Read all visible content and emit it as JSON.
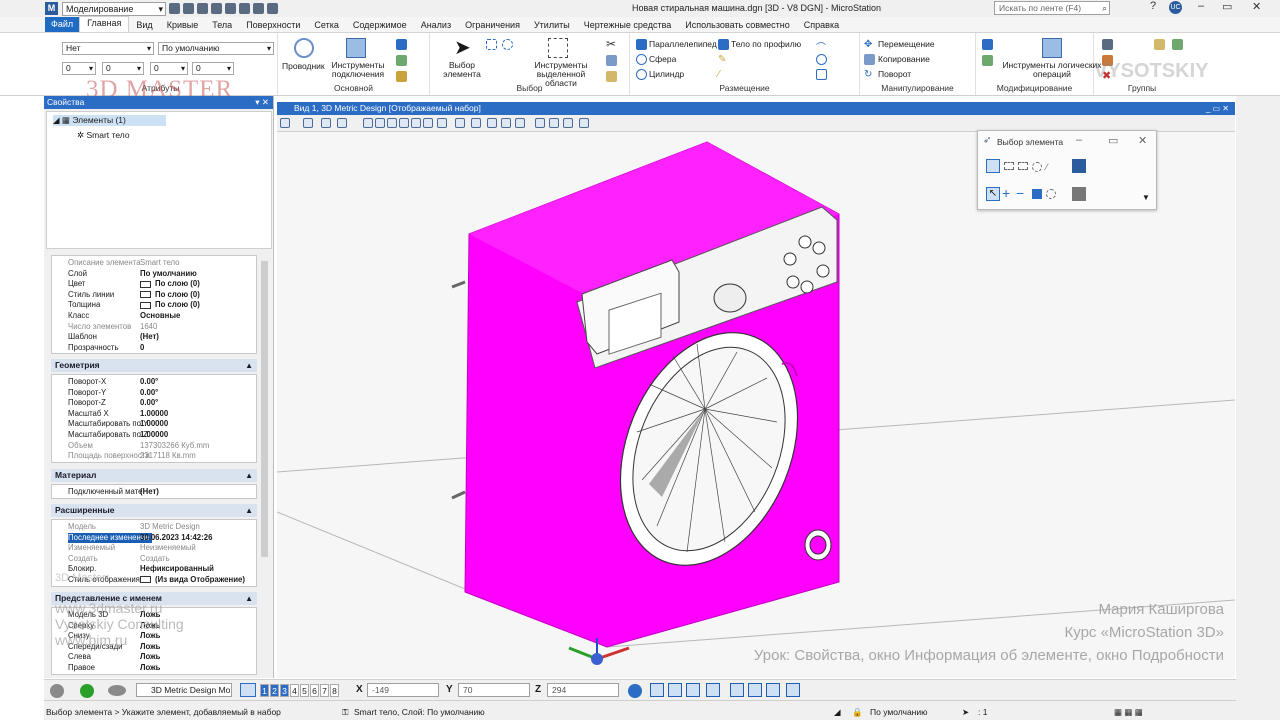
{
  "titlebar": {
    "workflow": "Моделирование",
    "document_title": "Новая стиральная машина.dgn [3D - V8 DGN] - MicroStation",
    "search_placeholder": "Искать по ленте (F4)",
    "user_initials": "UC"
  },
  "menu": [
    "Файл",
    "Главная",
    "Вид",
    "Кривые",
    "Тела",
    "Поверхности",
    "Сетка",
    "Содержимое",
    "Анализ",
    "Ограничения",
    "Утилиты",
    "Чертежные средства",
    "Использовать совместно",
    "Справка"
  ],
  "menu_active": "Главная",
  "ribbon": {
    "attributes": {
      "level": "Нет",
      "style": "По умолчанию",
      "color": "0",
      "weight": "0",
      "transparency": "0",
      "priority": "0",
      "label": "Атрибуты"
    },
    "main_group": {
      "explorer": "Проводник",
      "attach_tools": "Инструменты подключения",
      "label": "Основной"
    },
    "selection_group": {
      "select_element": "Выбор элемента",
      "area_tools": "Инструменты выделенной области",
      "label": "Выбор"
    },
    "placement_group": {
      "items": [
        "Параллелепипед",
        "Сфера",
        "Цилиндр",
        "Тело по профилю"
      ],
      "label": "Размещение"
    },
    "manipulate_group": {
      "items": [
        "Перемещение",
        "Копирование",
        "Поворот"
      ],
      "label": "Манипулирование"
    },
    "modify_group": {
      "boolean_tools": "Инструменты логических операций",
      "label": "Модифицирование"
    },
    "groups_group": {
      "label": "Группы"
    }
  },
  "watermark": {
    "top": "3D MASTER",
    "right": "VYSOTSKIY"
  },
  "properties_panel": {
    "title": "Свойства",
    "tree": {
      "root": "Элементы (1)",
      "child": "Smart тело"
    },
    "general": [
      {
        "k": "Описание элемента",
        "v": "Smart тело",
        "dim": true
      },
      {
        "k": "Слой",
        "v": "По умолчанию"
      },
      {
        "k": "Цвет",
        "v": "По слою (0)",
        "swatch": true
      },
      {
        "k": "Стиль линии",
        "v": "По слою (0)",
        "swatch": true
      },
      {
        "k": "Толщина",
        "v": "По слою (0)",
        "swatch": true
      },
      {
        "k": "Класс",
        "v": "Основные"
      },
      {
        "k": "Число элементов",
        "v": "1640",
        "dim": true
      },
      {
        "k": "Шаблон",
        "v": "(Нет)"
      },
      {
        "k": "Прозрачность",
        "v": "0"
      }
    ],
    "geometry": {
      "title": "Геометрия",
      "rows": [
        {
          "k": "Поворот-X",
          "v": "0.00°"
        },
        {
          "k": "Поворот-Y",
          "v": "0.00°"
        },
        {
          "k": "Поворот-Z",
          "v": "0.00°"
        },
        {
          "k": "Масштаб X",
          "v": "1.00000"
        },
        {
          "k": "Масштабировать по Y",
          "v": "1.00000"
        },
        {
          "k": "Масштабировать по Z",
          "v": "1.00000"
        },
        {
          "k": "Объем",
          "v": "137303266  Куб.mm",
          "dim": true
        },
        {
          "k": "Площадь поверхности",
          "v": "2317118  Кв.mm",
          "dim": true
        }
      ]
    },
    "material": {
      "title": "Материал",
      "rows": [
        {
          "k": "Подключенный мате",
          "v": "(Нет)"
        }
      ]
    },
    "extended": {
      "title": "Расширенные",
      "rows": [
        {
          "k": "Модель",
          "v": "3D Metric Design",
          "dim": true
        },
        {
          "k": "Последнее изменение",
          "v": "30.06.2023 14:42:26",
          "hl": true
        },
        {
          "k": "Изменяемый",
          "v": "Неизменяемый",
          "dim": true
        },
        {
          "k": "Создать",
          "v": "Создать",
          "dim": true
        },
        {
          "k": "Блокир.",
          "v": "Нефиксированный"
        },
        {
          "k": "Стиль отображения",
          "v": "(Из вида Отображение)",
          "swatch": true
        }
      ]
    },
    "named": {
      "title": "Представление с именем",
      "rows": [
        {
          "k": "Модель 3D",
          "v": "Ложь"
        },
        {
          "k": "Сверху",
          "v": "Ложь"
        },
        {
          "k": "Снизу",
          "v": "Ложь"
        },
        {
          "k": "Спереди/сзади",
          "v": "Ложь"
        },
        {
          "k": "Слева",
          "v": "Ложь"
        },
        {
          "k": "Правое",
          "v": "Ложь"
        }
      ]
    }
  },
  "overlay_text": {
    "line1": "3D Master",
    "line2": "www.3dmaster.ru",
    "line3": "Vysotskiy Consulting",
    "line4": "www.bim.ru"
  },
  "view": {
    "title": "Вид 1, 3D Metric Design [Отображаемый набор]"
  },
  "element_selection_dialog": {
    "title": "Выбор элемента"
  },
  "credit": {
    "author": "Мария Каширгова",
    "course": "Курс «MicroStation 3D»",
    "lesson": "Урок: Свойства, окно Информация об элементе, окно Подробности"
  },
  "bottom_toolbar": {
    "model": "3D Metric Design Mo",
    "views": [
      "1",
      "2",
      "3",
      "4",
      "5",
      "6",
      "7",
      "8"
    ],
    "active_views": [
      "1",
      "2",
      "3"
    ],
    "x_label": "X",
    "x": "-149",
    "y_label": "Y",
    "y": "70",
    "z_label": "Z",
    "z": "294"
  },
  "status": {
    "prompt": "Выбор элемента > Укажите элемент, добавляемый в набор",
    "info": "Smart тело, Слой: По умолчанию",
    "level": "По умолчанию",
    "sel_count": ": 1"
  },
  "colors": {
    "accent": "#2b6cc4",
    "solid": "#ff00ff"
  }
}
